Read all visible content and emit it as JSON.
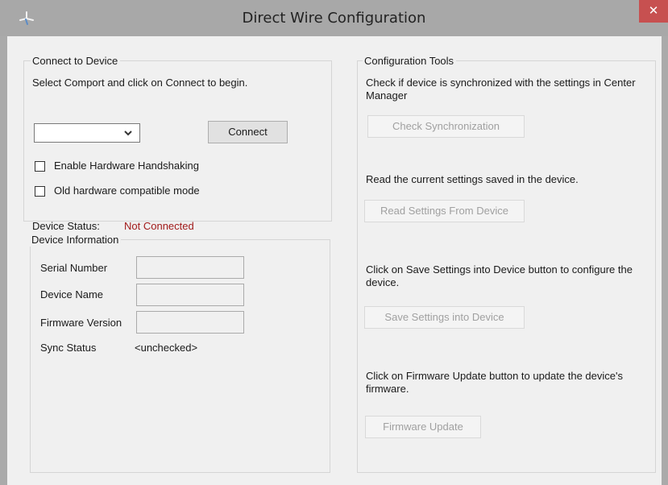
{
  "window": {
    "title": "Direct Wire Configuration",
    "close_glyph": "✕"
  },
  "connect": {
    "legend": "Connect to Device",
    "instruction": "Select Comport and click on Connect to begin.",
    "comport_value": "",
    "connect_label": "Connect",
    "handshaking_label": "Enable Hardware Handshaking",
    "handshaking_checked": false,
    "compat_label": "Old hardware compatible mode",
    "compat_checked": false,
    "status_label": "Device Status:",
    "status_value": "Not Connected",
    "status_color": "#a11a1a"
  },
  "device_info": {
    "legend": "Device Information",
    "serial_label": "Serial Number",
    "serial_value": "",
    "name_label": "Device Name",
    "name_value": "",
    "firmware_label": "Firmware Version",
    "firmware_value": "",
    "sync_label": "Sync Status",
    "sync_value": "<unchecked>"
  },
  "tools": {
    "legend": "Configuration Tools",
    "sync_desc": "Check if device is synchronized with the settings in Center Manager",
    "sync_button": "Check Synchronization",
    "read_desc": "Read the current settings saved in the device.",
    "read_button": "Read Settings From Device",
    "save_desc": "Click on Save Settings into Device button to configure the device.",
    "save_button": "Save Settings into Device",
    "update_desc": "Click on Firmware Update button to update the device's firmware.",
    "update_button": "Firmware Update"
  },
  "icons": {
    "app": "app-icon",
    "close": "close-icon",
    "dropdown": "chevron-down-icon"
  }
}
